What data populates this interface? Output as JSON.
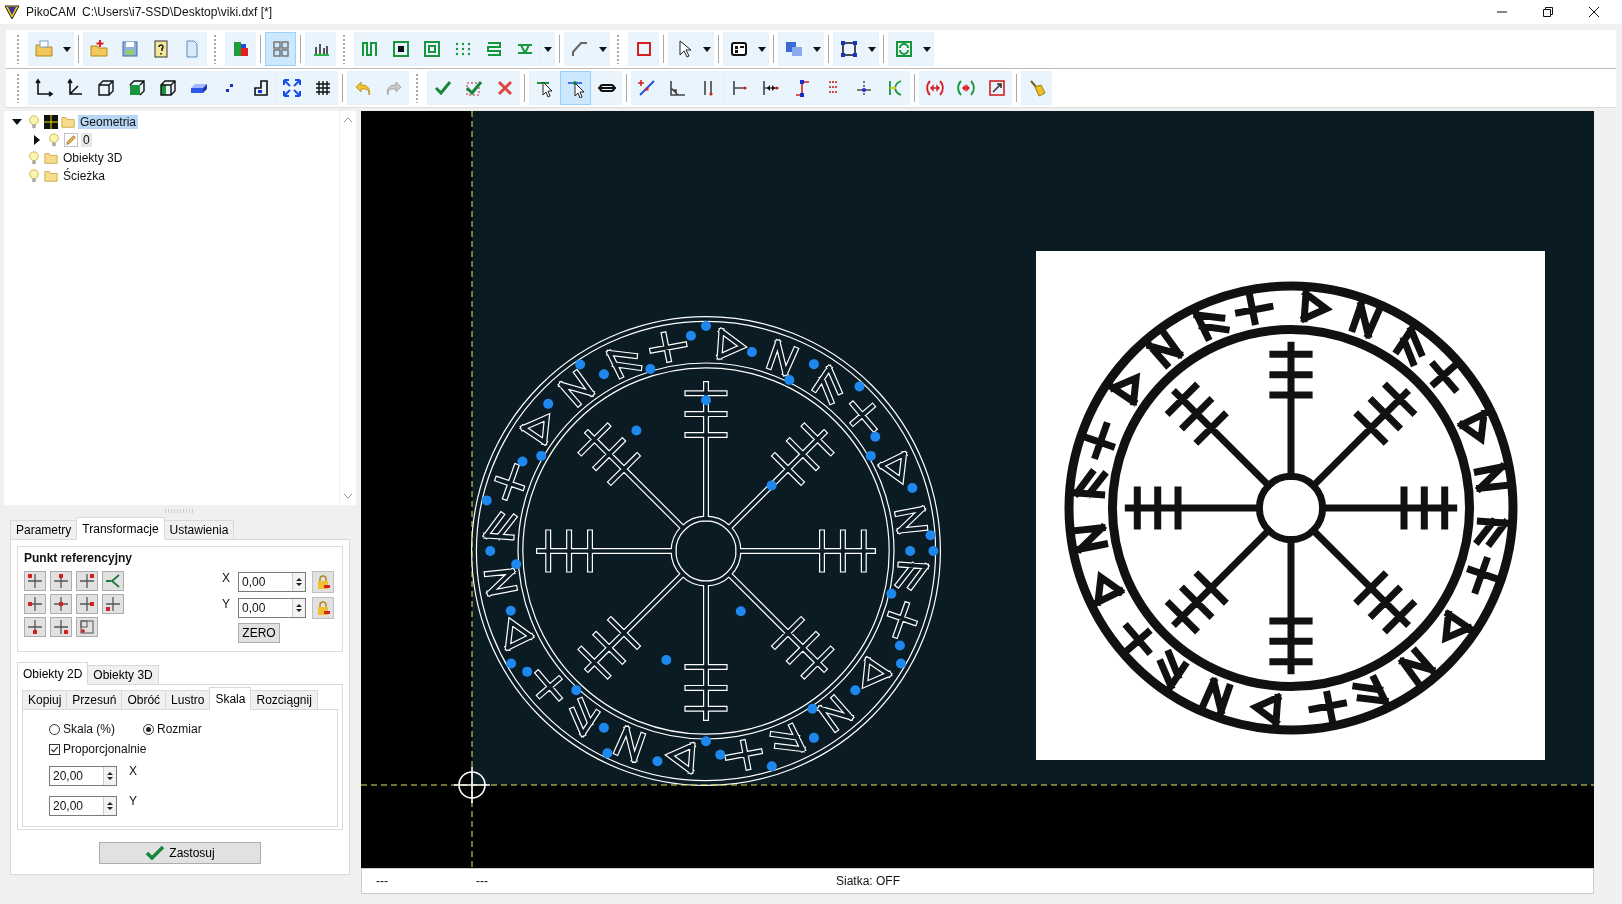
{
  "window": {
    "app_name": "PikoCAM",
    "title": "C:\\Users\\i7-SSD\\Desktop\\viki.dxf [*]"
  },
  "toolbar_top": [
    {
      "grip": true,
      "buttons": [
        {
          "kind": "open",
          "selected": false,
          "dropdown": true
        }
      ]
    },
    {
      "grip": false,
      "buttons": [
        {
          "kind": "new-folder",
          "selected": false
        },
        {
          "kind": "save",
          "selected": false
        },
        {
          "kind": "help",
          "selected": false
        },
        {
          "kind": "page",
          "selected": false
        }
      ]
    },
    {
      "grip": true,
      "buttons": [
        {
          "kind": "color-chart",
          "selected": false
        }
      ]
    },
    {
      "grip": false,
      "buttons": [
        {
          "kind": "tiles",
          "selected": true
        }
      ]
    },
    {
      "grip": false,
      "buttons": [
        {
          "kind": "bars",
          "selected": false
        }
      ]
    },
    {
      "grip": true,
      "buttons": [
        {
          "kind": "zigzag",
          "selected": false
        },
        {
          "kind": "square-filled",
          "selected": false
        },
        {
          "kind": "square-nested",
          "selected": false
        },
        {
          "kind": "dots",
          "selected": false
        },
        {
          "kind": "lines",
          "selected": false
        },
        {
          "kind": "hatch",
          "selected": false,
          "dropdown": true
        }
      ]
    },
    {
      "grip": false,
      "buttons": [
        {
          "kind": "bend",
          "selected": false,
          "dropdown": true
        }
      ]
    },
    {
      "grip": true,
      "buttons": [
        {
          "kind": "red-square",
          "selected": false
        }
      ]
    },
    {
      "grip": false,
      "buttons": [
        {
          "kind": "cursor",
          "selected": false,
          "dropdown": true
        }
      ]
    },
    {
      "grip": false,
      "buttons": [
        {
          "kind": "window",
          "selected": false,
          "dropdown": true
        }
      ]
    },
    {
      "grip": false,
      "buttons": [
        {
          "kind": "shapes",
          "selected": false,
          "dropdown": true
        }
      ]
    },
    {
      "grip": false,
      "buttons": [
        {
          "kind": "nodes",
          "selected": false,
          "dropdown": true
        }
      ]
    },
    {
      "grip": false,
      "buttons": [
        {
          "kind": "refresh",
          "selected": false,
          "dropdown": true
        }
      ]
    }
  ],
  "toolbar_bottom": [
    {
      "grip": true,
      "buttons": [
        {
          "kind": "axis",
          "selected": false
        },
        {
          "kind": "axis3",
          "selected": false
        },
        {
          "kind": "cube",
          "selected": false
        },
        {
          "kind": "cube-green",
          "selected": false
        },
        {
          "kind": "cube-side",
          "selected": false
        },
        {
          "kind": "block",
          "selected": false
        },
        {
          "kind": "small-dots",
          "selected": false
        },
        {
          "kind": "step",
          "selected": false
        },
        {
          "kind": "expand",
          "selected": false
        },
        {
          "kind": "grid",
          "selected": false
        }
      ]
    },
    {
      "grip": false,
      "buttons": [
        {
          "kind": "undo",
          "selected": false
        },
        {
          "kind": "redo",
          "selected": false
        }
      ]
    },
    {
      "grip": true,
      "buttons": [
        {
          "kind": "check"
        },
        {
          "kind": "check-dashed"
        },
        {
          "kind": "cross"
        }
      ]
    },
    {
      "grip": false,
      "buttons": [
        {
          "kind": "pick",
          "selected": false
        },
        {
          "kind": "pick-move",
          "selected": true
        },
        {
          "kind": "link",
          "selected": false
        }
      ]
    },
    {
      "grip": false,
      "buttons": [
        {
          "kind": "line-point",
          "selected": false
        },
        {
          "kind": "angle",
          "selected": false
        },
        {
          "kind": "parallel",
          "selected": false
        },
        {
          "kind": "perp",
          "selected": false
        },
        {
          "kind": "dist",
          "selected": false
        },
        {
          "kind": "corner",
          "selected": false
        },
        {
          "kind": "dotted",
          "selected": false
        },
        {
          "kind": "mid",
          "selected": false
        },
        {
          "kind": "tangent",
          "selected": false
        }
      ]
    },
    {
      "grip": false,
      "buttons": [
        {
          "kind": "bracket-red",
          "selected": false
        },
        {
          "kind": "bracket-green",
          "selected": false
        },
        {
          "kind": "box-arrow",
          "selected": false
        }
      ]
    },
    {
      "grip": false,
      "buttons": [
        {
          "kind": "broom",
          "selected": false
        }
      ]
    }
  ],
  "tree": [
    {
      "label": "Geometria",
      "kind": "group",
      "selected": true,
      "expanded": true,
      "children": [
        {
          "label": "0",
          "kind": "layer",
          "selected": false,
          "expanded": false
        }
      ]
    },
    {
      "label": "Obiekty 3D",
      "kind": "folder",
      "selected": false
    },
    {
      "label": "Ścieżka",
      "kind": "folder",
      "selected": false
    }
  ],
  "panel_tabs": [
    {
      "label": "Parametry",
      "selected": false
    },
    {
      "label": "Transformacje",
      "selected": true
    },
    {
      "label": "Ustawienia",
      "selected": false
    }
  ],
  "reference_point": {
    "title": "Punkt referencyjny",
    "fields": [
      {
        "label": "X",
        "value": "0,00"
      },
      {
        "label": "Y",
        "value": "0,00"
      }
    ],
    "zero_button": "ZERO"
  },
  "object_tabs": [
    {
      "label": "Obiekty 2D",
      "selected": true
    },
    {
      "label": "Obiekty 3D",
      "selected": false
    }
  ],
  "operation_tabs": [
    {
      "label": "Kopiuj",
      "selected": false
    },
    {
      "label": "Przesuń",
      "selected": false
    },
    {
      "label": "Obróć",
      "selected": false
    },
    {
      "label": "Lustro",
      "selected": false
    },
    {
      "label": "Skala",
      "selected": true
    },
    {
      "label": "Rozciągnij",
      "selected": false
    }
  ],
  "scale_mode": [
    {
      "label": "Skala (%)",
      "selected": false
    },
    {
      "label": "Rozmiar",
      "selected": true
    }
  ],
  "proportional": {
    "label": "Proporcjonalnie",
    "checked": true
  },
  "size_fields": [
    {
      "value": "20,00",
      "label": "X"
    },
    {
      "value": "20,00",
      "label": "Y"
    }
  ],
  "apply_button": "Zastosuj",
  "status_bar": [
    "---",
    "---",
    "Siatka: OFF"
  ]
}
